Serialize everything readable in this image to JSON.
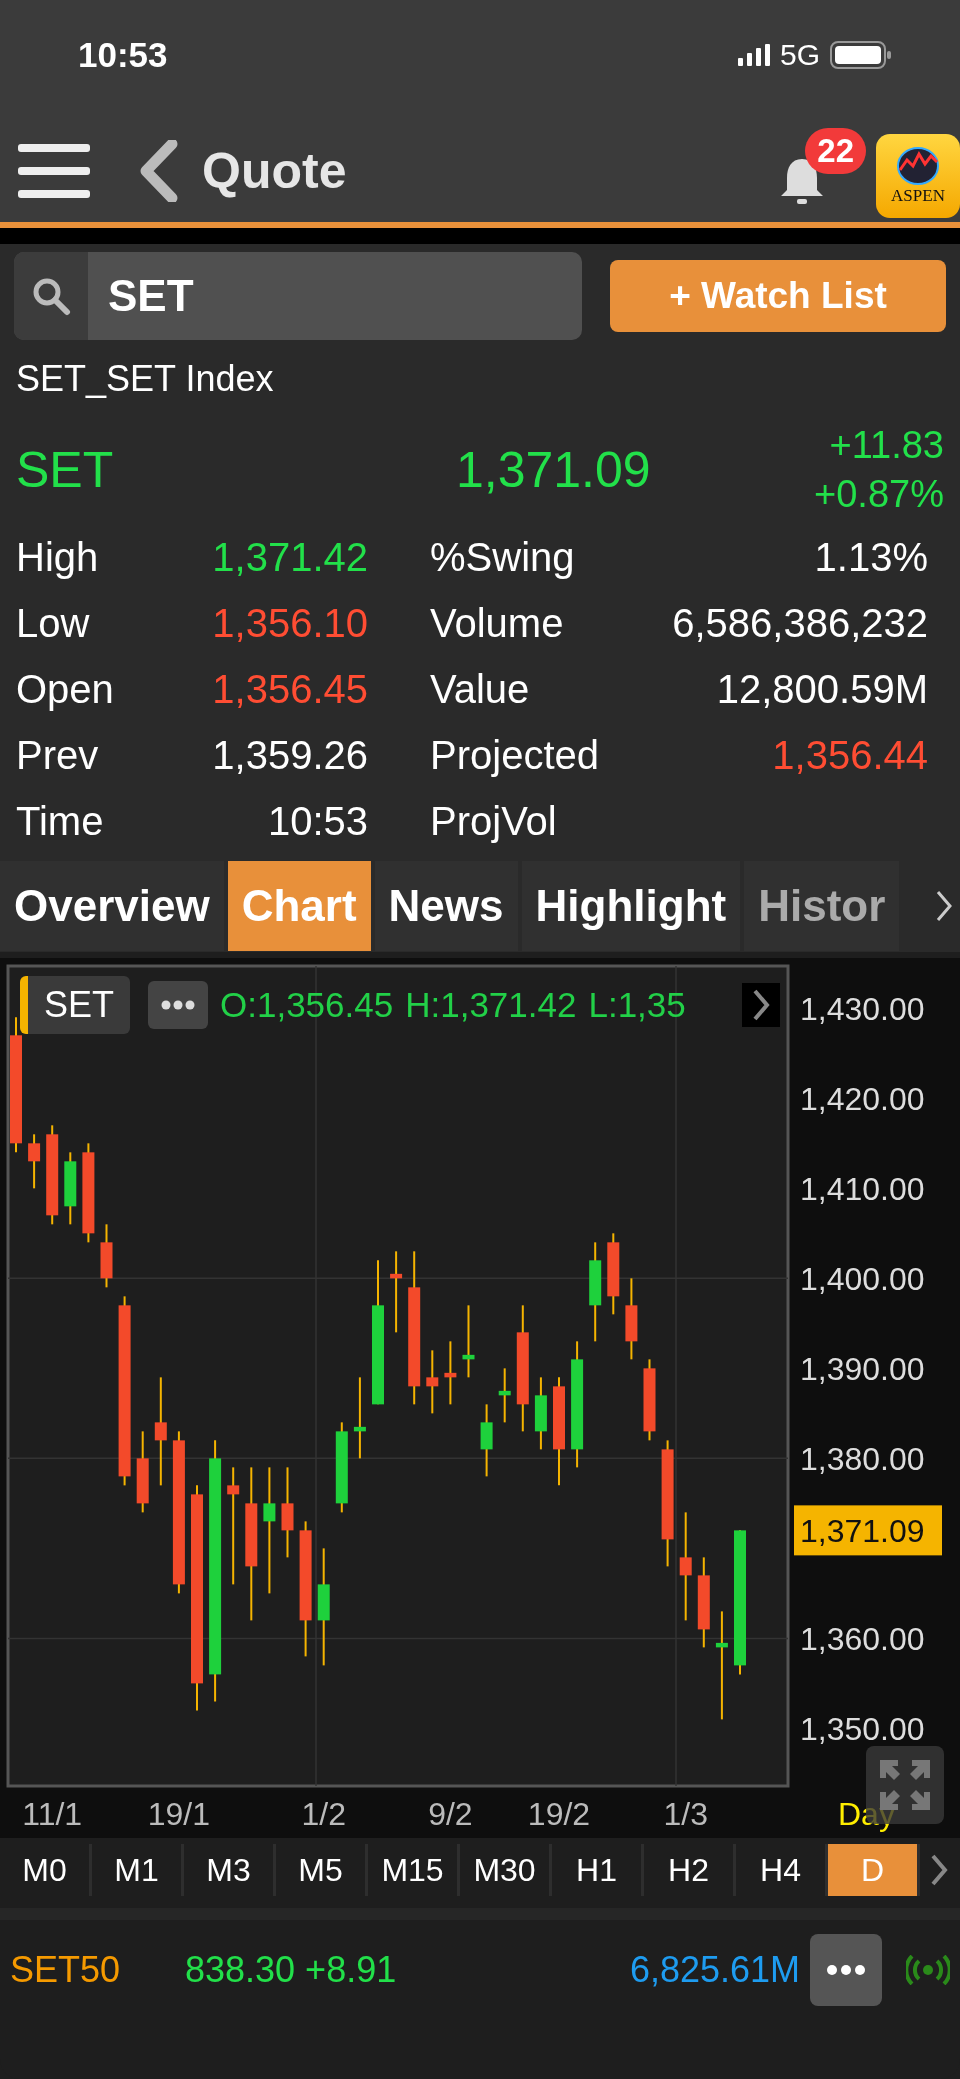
{
  "status_bar": {
    "time": "10:53",
    "network": "5G"
  },
  "nav": {
    "title": "Quote",
    "notification_count": "22",
    "logo_text": "ASPEN"
  },
  "search": {
    "value": "SET"
  },
  "watch_button": "+ Watch List",
  "symbol_name": "SET_SET Index",
  "quote": {
    "symbol": "SET",
    "last": "1,371.09",
    "change": "+11.83",
    "percent": "+0.87%"
  },
  "stats": [
    {
      "label": "High",
      "value": "1,371.42",
      "color": "#22e04a"
    },
    {
      "label": "%Swing",
      "value": "1.13%",
      "color": "#ffffff"
    },
    {
      "label": "Low",
      "value": "1,356.10",
      "color": "#ff4d33"
    },
    {
      "label": "Volume",
      "value": "6,586,386,232",
      "color": "#ffffff"
    },
    {
      "label": "Open",
      "value": "1,356.45",
      "color": "#ff4d33"
    },
    {
      "label": "Value",
      "value": "12,800.59M",
      "color": "#ffffff"
    },
    {
      "label": "Prev",
      "value": "1,359.26",
      "color": "#ffffff"
    },
    {
      "label": "Projected",
      "value": "1,356.44",
      "color": "#ff4d33"
    },
    {
      "label": "Time",
      "value": "10:53",
      "color": "#ffffff"
    },
    {
      "label": "ProjVol"
    }
  ],
  "tabs": [
    {
      "label": "Overview",
      "selected": false
    },
    {
      "label": "Chart",
      "selected": true
    },
    {
      "label": "News",
      "selected": false
    },
    {
      "label": "Highlight",
      "selected": false
    },
    {
      "label": "Histor",
      "selected": false
    }
  ],
  "chart": {
    "symbol": "SET",
    "ohlc": [
      "O:1,356.45",
      "H:1,371.42",
      "L:1,35"
    ],
    "last_price": "1,371.09",
    "period": "Day",
    "chart_data": {
      "type": "candlestick",
      "grid": true,
      "categories": [
        null,
        null,
        "11/1",
        null,
        null,
        null,
        null,
        null,
        null,
        "19/1",
        null,
        null,
        null,
        null,
        null,
        null,
        null,
        "1/2",
        null,
        null,
        null,
        null,
        null,
        null,
        "9/2",
        null,
        null,
        null,
        null,
        null,
        "19/2",
        null,
        null,
        null,
        null,
        null,
        null,
        "1/3",
        null,
        null,
        null
      ],
      "ohlc": [
        [
          1427,
          1429,
          1414,
          1415
        ],
        [
          1415,
          1416,
          1410,
          1413
        ],
        [
          1416,
          1417,
          1406,
          1407
        ],
        [
          1408,
          1414,
          1406,
          1413
        ],
        [
          1414,
          1415,
          1404,
          1405
        ],
        [
          1404,
          1406,
          1399,
          1400
        ],
        [
          1397,
          1398,
          1377,
          1378
        ],
        [
          1380,
          1383,
          1374,
          1375
        ],
        [
          1384,
          1389,
          1377,
          1382
        ],
        [
          1382,
          1383,
          1365,
          1366
        ],
        [
          1376,
          1377,
          1352,
          1355
        ],
        [
          1356,
          1382,
          1353,
          1380
        ],
        [
          1377,
          1379,
          1366,
          1376
        ],
        [
          1375,
          1379,
          1362,
          1368
        ],
        [
          1373,
          1379,
          1365,
          1375
        ],
        [
          1375,
          1379,
          1369,
          1372
        ],
        [
          1372,
          1373,
          1358,
          1362
        ],
        [
          1362,
          1370,
          1357,
          1366
        ],
        [
          1375,
          1384,
          1374,
          1383
        ],
        [
          1383,
          1389,
          1380,
          1383.5
        ],
        [
          1386,
          1402,
          1386,
          1397
        ],
        [
          1400.5,
          1403,
          1394,
          1400
        ],
        [
          1399,
          1403,
          1386,
          1388
        ],
        [
          1389,
          1392,
          1385,
          1388
        ],
        [
          1389.5,
          1393,
          1386,
          1389
        ],
        [
          1391,
          1397,
          1389,
          1391.5
        ],
        [
          1381,
          1386,
          1378,
          1384
        ],
        [
          1387,
          1390,
          1384,
          1387.5
        ],
        [
          1394,
          1397,
          1383,
          1386
        ],
        [
          1383,
          1389,
          1381,
          1387
        ],
        [
          1388,
          1389,
          1377,
          1381
        ],
        [
          1381,
          1393,
          1379,
          1391
        ],
        [
          1397,
          1404,
          1393,
          1402
        ],
        [
          1404,
          1405,
          1396,
          1398
        ],
        [
          1397,
          1400,
          1391,
          1393
        ],
        [
          1390,
          1391,
          1382,
          1383
        ],
        [
          1381,
          1382,
          1368,
          1371
        ],
        [
          1369,
          1374,
          1362,
          1367
        ],
        [
          1367,
          1369,
          1359,
          1361
        ],
        [
          1359,
          1363,
          1351,
          1359.5
        ],
        [
          1357,
          1372,
          1356,
          1372
        ]
      ],
      "ylim": [
        1343.6,
        1434.7
      ],
      "yticks": [
        {
          "value": 1430,
          "label": "1,430.00"
        },
        {
          "value": 1420,
          "label": "1,420.00"
        },
        {
          "value": 1410,
          "label": "1,410.00"
        },
        {
          "value": 1400,
          "label": "1,400.00"
        },
        {
          "value": 1390,
          "label": "1,390.00"
        },
        {
          "value": 1380,
          "label": "1,380.00"
        },
        {
          "value": 1360,
          "label": "1,360.00"
        },
        {
          "value": 1350,
          "label": "1,350.00"
        }
      ]
    }
  },
  "timeframes": [
    {
      "label": "M0",
      "selected": false
    },
    {
      "label": "M1",
      "selected": false
    },
    {
      "label": "M3",
      "selected": false
    },
    {
      "label": "M5",
      "selected": false
    },
    {
      "label": "M15",
      "selected": false
    },
    {
      "label": "M30",
      "selected": false
    },
    {
      "label": "H1",
      "selected": false
    },
    {
      "label": "H2",
      "selected": false
    },
    {
      "label": "H4",
      "selected": false
    },
    {
      "label": "D",
      "selected": true
    }
  ],
  "ticker": {
    "symbol": "SET50",
    "price": "838.30 +8.91",
    "value": "6,825.61M"
  }
}
